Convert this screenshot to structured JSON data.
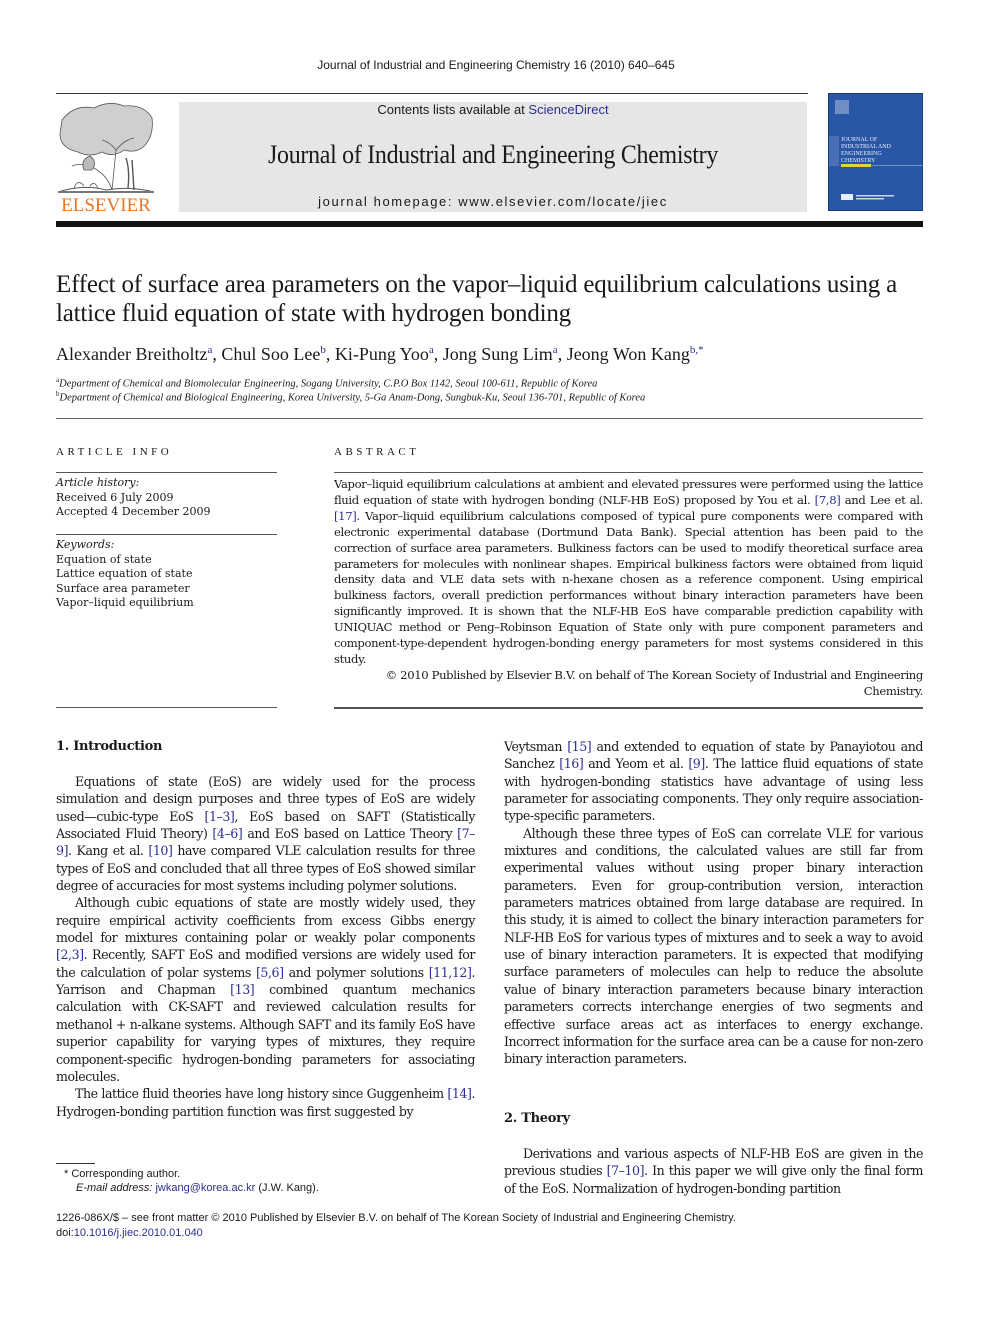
{
  "running_head": "Journal of Industrial and Engineering Chemistry 16 (2010) 640–645",
  "header": {
    "publisher_logo_text": "ELSEVIER",
    "contents_prefix": "Contents lists available at ",
    "contents_link": "ScienceDirect",
    "journal_title": "Journal of Industrial and Engineering Chemistry",
    "homepage": "journal homepage: www.elsevier.com/locate/jiec",
    "cover_title_lines": [
      "JOURNAL OF",
      "INDUSTRIAL AND",
      "ENGINEERING",
      "CHEMISTRY"
    ],
    "colors": {
      "header_box": "#e6e6e6",
      "cover": "#2a57a5",
      "logo_orange": "#e87722",
      "link": "#2b2f8f"
    }
  },
  "article": {
    "title": "Effect of surface area parameters on the vapor–liquid equilibrium calculations using a lattice fluid equation of state with hydrogen bonding",
    "authors": [
      {
        "name": "Alexander Breitholtz",
        "sup": "a",
        "sep": ", "
      },
      {
        "name": "Chul Soo Lee",
        "sup": "b",
        "sep": ", "
      },
      {
        "name": "Ki-Pung Yoo",
        "sup": "a",
        "sep": ", "
      },
      {
        "name": "Jong Sung Lim",
        "sup": "a",
        "sep": ", "
      },
      {
        "name": "Jeong Won Kang",
        "sup": "b,*",
        "sep": ""
      }
    ],
    "affiliations": [
      {
        "mark": "a",
        "text": "Department of Chemical and Biomolecular Engineering, Sogang University, C.P.O Box 1142, Seoul 100-611, Republic of Korea"
      },
      {
        "mark": "b",
        "text": "Department of Chemical and Biological Engineering, Korea University, 5-Ga Anam-Dong, Sungbuk-Ku, Seoul 136-701, Republic of Korea"
      }
    ]
  },
  "article_info": {
    "heading": "ARTICLE INFO",
    "history_label": "Article history:",
    "received": "Received 6 July 2009",
    "accepted": "Accepted 4 December 2009",
    "keywords_label": "Keywords:",
    "keywords": [
      "Equation of state",
      "Lattice equation of state",
      "Surface area parameter",
      "Vapor–liquid equilibrium"
    ]
  },
  "abstract": {
    "heading": "ABSTRACT",
    "parts": [
      {
        "t": "Vapor–liquid equilibrium calculations at ambient and elevated pressures were performed using the lattice fluid equation of state with hydrogen bonding (NLF-HB EoS) proposed by You et al. "
      },
      {
        "t": "[7,8]",
        "link": true
      },
      {
        "t": " and Lee et al. "
      },
      {
        "t": "[17]",
        "link": true
      },
      {
        "t": ". Vapor–liquid equilibrium calculations composed of typical pure components were compared with electronic experimental database (Dortmund Data Bank). Special attention has been paid to the correction of surface area parameters. Bulkiness factors can be used to modify theoretical surface area parameters for molecules with nonlinear shapes. Empirical bulkiness factors were obtained from liquid density data and VLE data sets with n-hexane chosen as a reference component. Using empirical bulkiness factors, overall prediction performances without binary interaction parameters have been significantly improved. It is shown that the NLF-HB EoS have comparable prediction capability with UNIQUAC method or Peng–Robinson Equation of State only with pure component parameters and component-type-dependent hydrogen-bonding energy parameters for most systems considered in this study."
      }
    ],
    "copyright": "© 2010 Published by Elsevier B.V. on behalf of The Korean Society of Industrial and Engineering Chemistry."
  },
  "sections": {
    "intro_heading": "1.  Introduction",
    "intro_paragraphs": [
      [
        {
          "t": "Equations of state (EoS) are widely used for the process simulation and design purposes and three types of EoS are widely used—cubic-type EoS "
        },
        {
          "t": "[1–3]",
          "link": true
        },
        {
          "t": ", EoS based on SAFT (Statistically Associated Fluid Theory) "
        },
        {
          "t": "[4–6]",
          "link": true
        },
        {
          "t": " and EoS based on Lattice Theory "
        },
        {
          "t": "[7–9]",
          "link": true
        },
        {
          "t": ". Kang et al. "
        },
        {
          "t": "[10]",
          "link": true
        },
        {
          "t": " have compared VLE calculation results for three types of EoS and concluded that all three types of EoS showed similar degree of accuracies for most systems including polymer solutions."
        }
      ],
      [
        {
          "t": "Although cubic equations of state are mostly widely used, they require empirical activity coefficients from excess Gibbs energy model for mixtures containing polar or weakly polar components "
        },
        {
          "t": "[2,3]",
          "link": true
        },
        {
          "t": ". Recently, SAFT EoS and modified versions are widely used for the calculation of polar systems "
        },
        {
          "t": "[5,6]",
          "link": true
        },
        {
          "t": " and polymer solutions "
        },
        {
          "t": "[11,12]",
          "link": true
        },
        {
          "t": ". Yarrison and Chapman "
        },
        {
          "t": "[13]",
          "link": true
        },
        {
          "t": " combined quantum mechanics calculation with CK-SAFT and reviewed calculation results for methanol + n-alkane systems. Although SAFT and its family EoS have superior capability for varying types of mixtures, they require component-specific hydrogen-bonding parameters for associating molecules."
        }
      ],
      [
        {
          "t": "The lattice fluid theories have long history since Guggenheim "
        },
        {
          "t": "[14]",
          "link": true
        },
        {
          "t": ". Hydrogen-bonding partition function was first suggested by"
        }
      ]
    ],
    "intro_right_paragraphs": [
      [
        {
          "t": "Veytsman "
        },
        {
          "t": "[15]",
          "link": true
        },
        {
          "t": " and extended to equation of state by Panayiotou and Sanchez "
        },
        {
          "t": "[16]",
          "link": true
        },
        {
          "t": " and Yeom et al. "
        },
        {
          "t": "[9]",
          "link": true
        },
        {
          "t": ". The lattice fluid equations of state with hydrogen-bonding statistics have advantage of using less parameter for associating components. They only require association-type-specific parameters."
        }
      ],
      [
        {
          "t": "Although these three types of EoS can correlate VLE for various mixtures and conditions, the calculated values are still far from experimental values without using proper binary interaction parameters. Even for group-contribution version, interaction parameters matrices obtained from large database are required. In this study, it is aimed to collect the binary interaction parameters for NLF-HB EoS for various types of mixtures and to seek a way to avoid use of binary interaction parameters. It is expected that modifying surface parameters of molecules can help to reduce the absolute value of binary interaction parameters because binary interaction parameters corrects interchange energies of two segments and effective surface areas act as interfaces to energy exchange. Incorrect information for the surface area can be a cause for non-zero binary interaction parameters."
        }
      ]
    ],
    "theory_heading": "2.  Theory",
    "theory_paragraphs": [
      [
        {
          "t": "Derivations and various aspects of NLF-HB EoS are given in the previous studies "
        },
        {
          "t": "[7–10]",
          "link": true
        },
        {
          "t": ". In this paper we will give only the final form of the EoS. Normalization of hydrogen-bonding partition"
        }
      ]
    ]
  },
  "footnotes": {
    "corresponding": "* Corresponding author.",
    "email_label": "E-mail address: ",
    "email": "jwkang@korea.ac.kr",
    "email_suffix": " (J.W. Kang)."
  },
  "footer": {
    "line1": "1226-086X/$ – see front matter © 2010 Published by Elsevier B.V. on behalf of The Korean Society of Industrial and Engineering Chemistry.",
    "doi_label": "doi:",
    "doi": "10.1016/j.jiec.2010.01.040"
  }
}
